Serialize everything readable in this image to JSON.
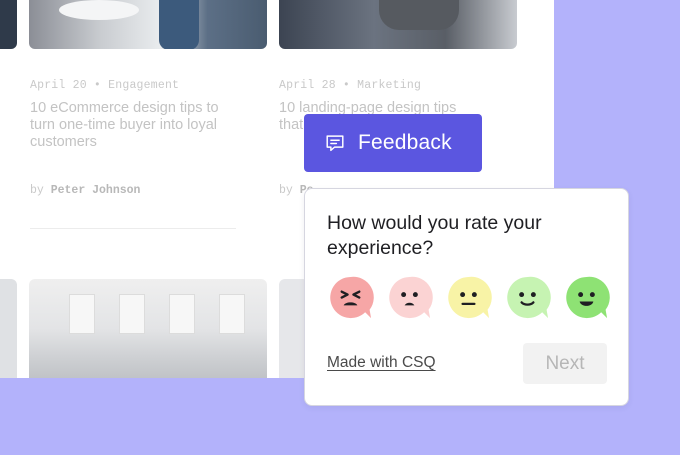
{
  "articles": [
    {
      "date": "April 20",
      "separator": "•",
      "category": "Engagement",
      "title": "10 eCommerce design tips to turn one-time buyer into loyal customers",
      "by_prefix": "by",
      "author": "Peter Johnson"
    },
    {
      "date": "April 28",
      "separator": "•",
      "category": "Marketing",
      "title": "10 landing-page design tips that con",
      "by_prefix": "by",
      "author": "Pe"
    }
  ],
  "feedback_tab": {
    "label": "Feedback",
    "icon": "message-icon",
    "color": "#5b56e0"
  },
  "survey": {
    "question": "How would you rate your experience?",
    "ratings": [
      {
        "name": "very-angry",
        "color": "#f6a6a6"
      },
      {
        "name": "sad",
        "color": "#fbd3d3"
      },
      {
        "name": "neutral",
        "color": "#f8f3a6"
      },
      {
        "name": "happy",
        "color": "#c6f3b2"
      },
      {
        "name": "very-happy",
        "color": "#8ee274"
      }
    ],
    "made_with": "Made with CSQ",
    "next_label": "Next"
  },
  "colors": {
    "background": "#b3b2fb",
    "page": "#ffffff"
  }
}
